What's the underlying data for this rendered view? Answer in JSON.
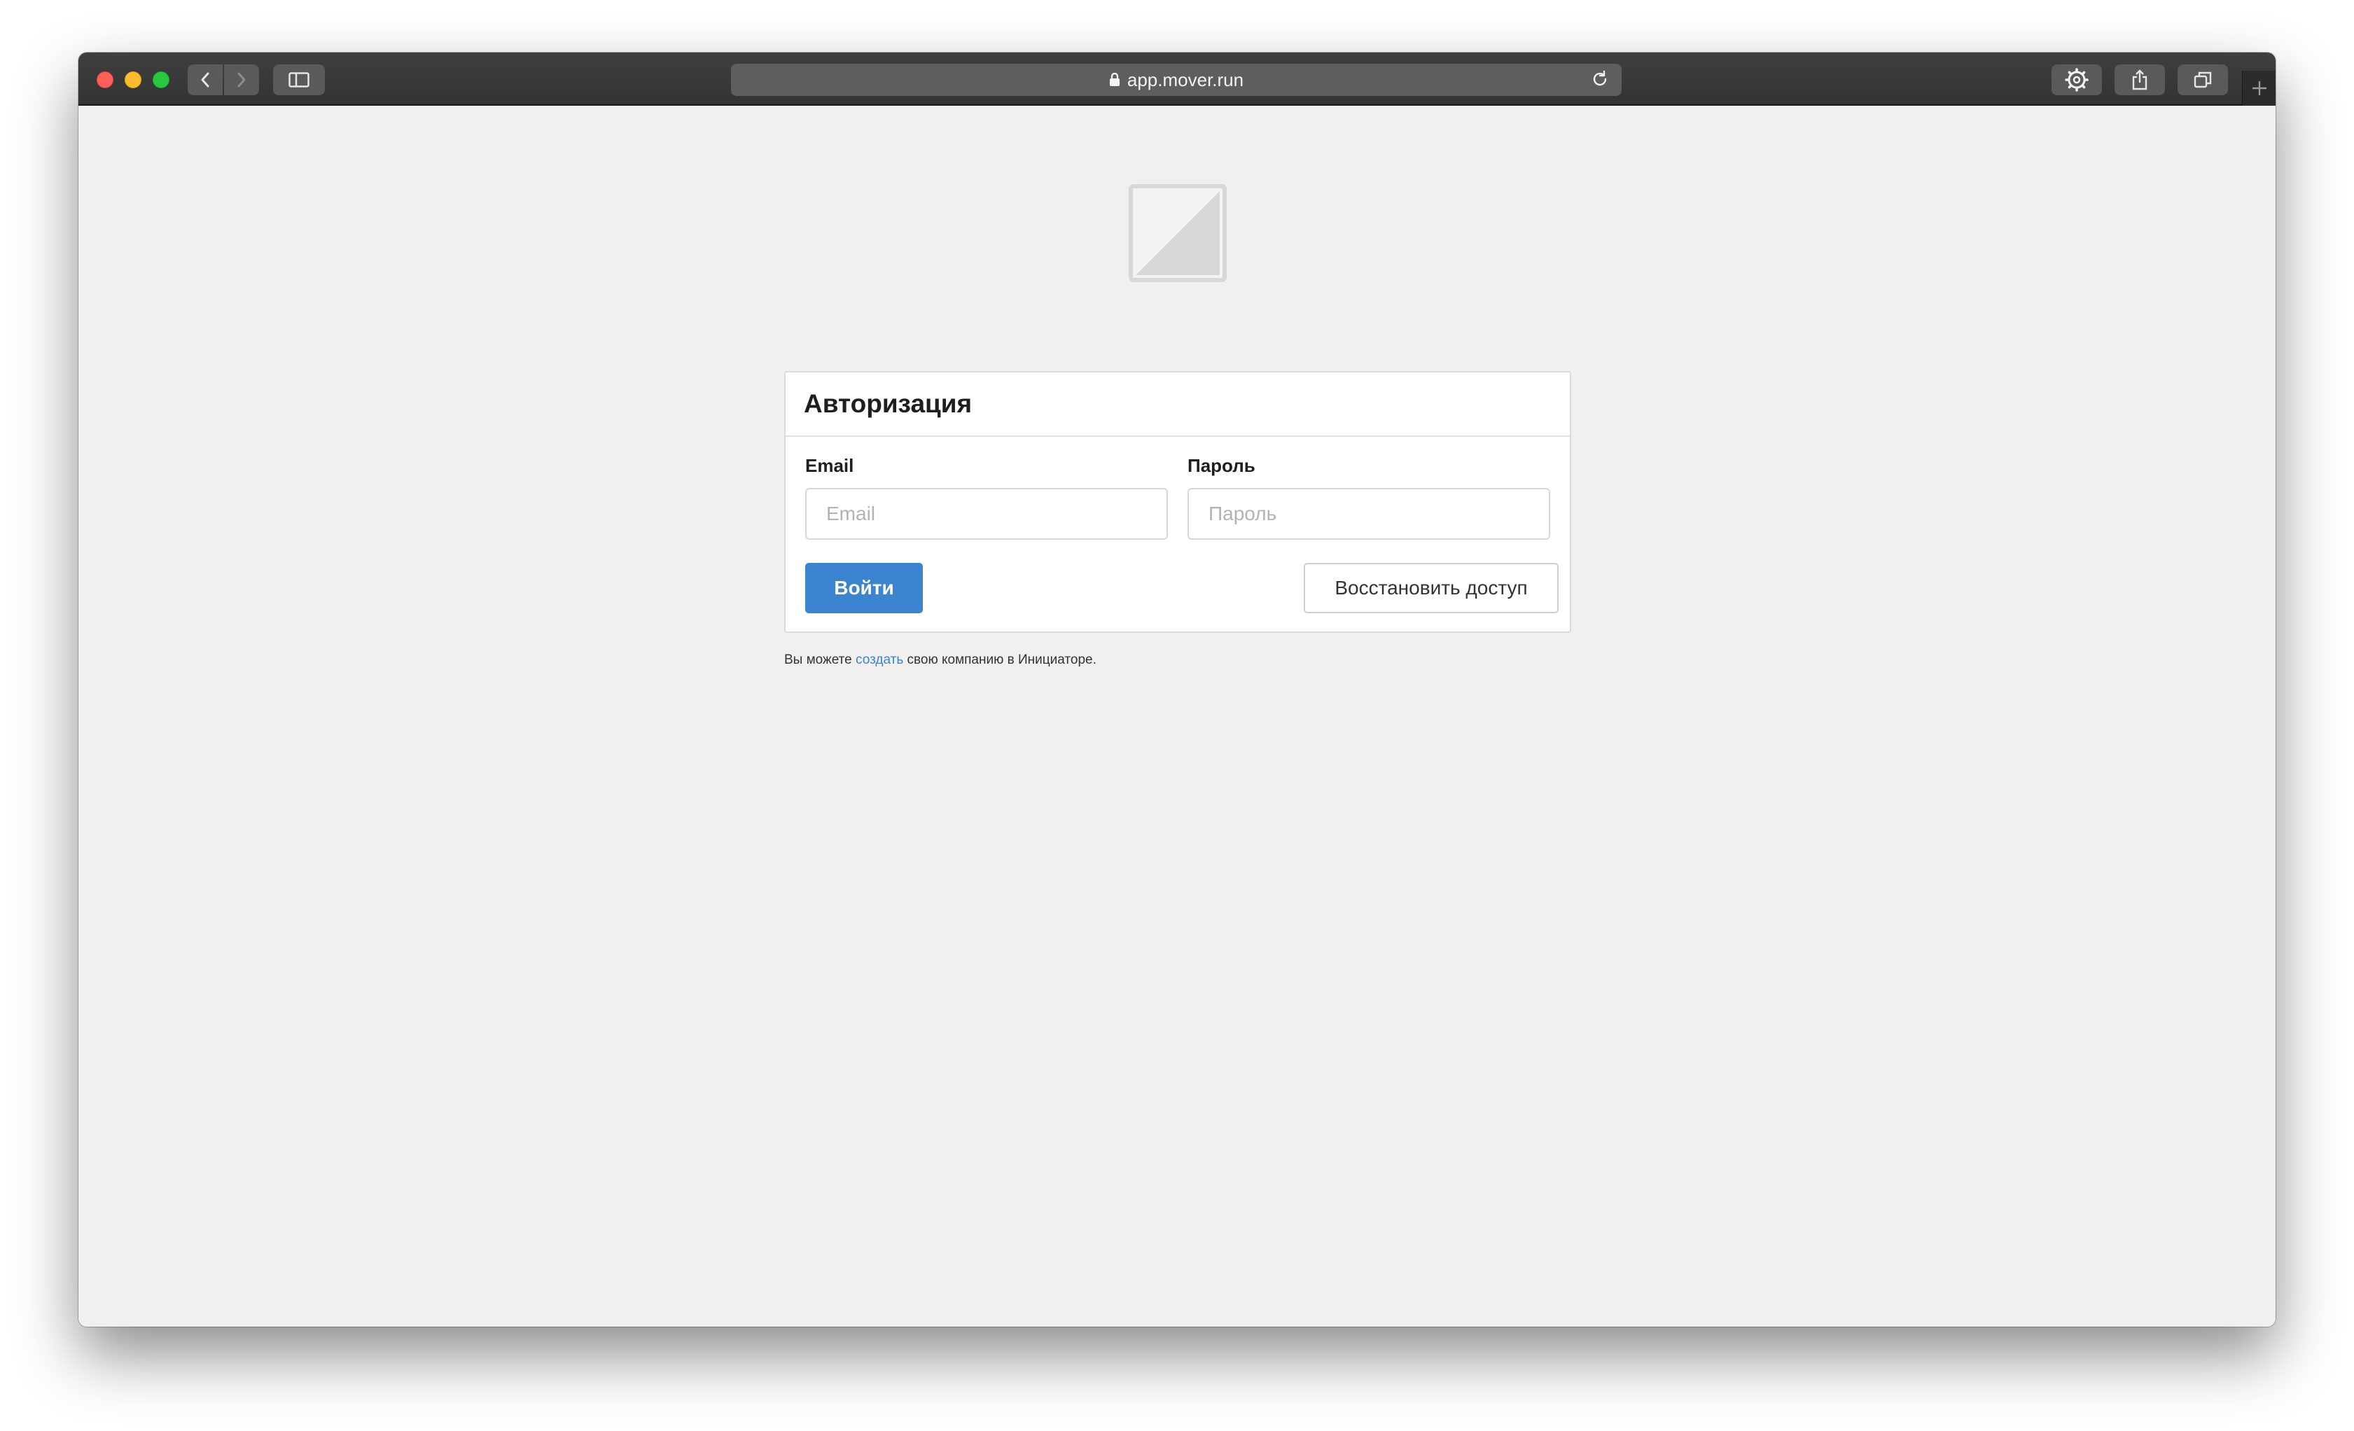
{
  "browser": {
    "address": "app.mover.run",
    "icons": {
      "back": "chevron-left-icon",
      "forward": "chevron-right-icon",
      "sidebar": "sidebar-icon",
      "lock": "lock-icon",
      "reload": "reload-icon",
      "settings": "gear-icon",
      "share": "share-icon",
      "tabs": "tabs-overview-icon",
      "new_tab": "plus-icon"
    }
  },
  "login": {
    "title": "Авторизация",
    "email_label": "Email",
    "email_placeholder": "Email",
    "email_value": "",
    "password_label": "Пароль",
    "password_placeholder": "Пароль",
    "password_value": "",
    "login_button": "Войти",
    "restore_button": "Восстановить доступ"
  },
  "footer": {
    "prefix": "Вы можете ",
    "link": "создать",
    "suffix": " свою компанию в Инициаторе."
  },
  "colors": {
    "accent": "#3a84d0",
    "page_background": "#f0f0f0",
    "toolbar": "#3a3a3a"
  }
}
